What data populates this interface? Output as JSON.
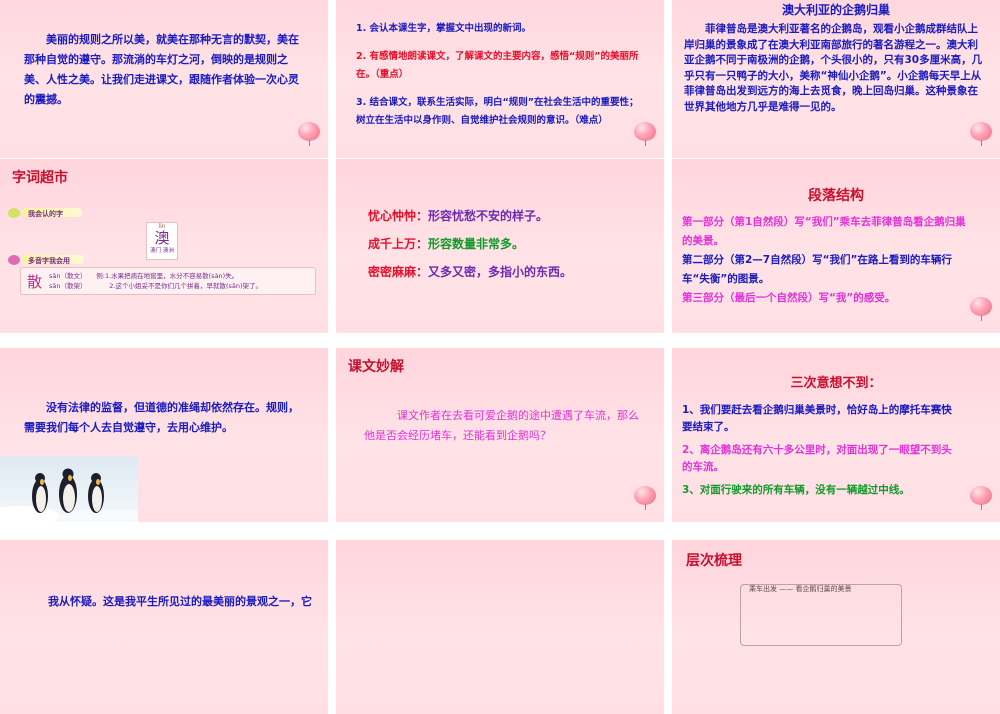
{
  "slides": {
    "s1": {
      "text": "美丽的规则之所以美，就美在那种无言的默契，美在那种自觉的遵守。那流淌的车灯之河，倒映的是规则之美、人性之美。让我们走进课文，跟随作者体验一次心灵的震撼。"
    },
    "s2": {
      "items": [
        "1. 会认本课生字，掌握文中出现的新词。",
        "2. 有感情地朗读课文，了解课文的主要内容，感悟“规则”的美丽所在。（重点）",
        "3. 结合课文，联系生活实际，明白“规则”在社会生活中的重要性；树立在生活中以身作则、自觉维护社会规则的意识。（难点）"
      ]
    },
    "s3": {
      "title": "澳大利亚的企鹅归巢",
      "text": "菲律普岛是澳大利亚著名的企鹅岛，观看小企鹅成群结队上岸归巢的景象成了在澳大利亚南部旅行的著名游程之一。澳大利亚企鹅不同于南极洲的企鹅，个头很小的，只有30多厘米高，几乎只有一只鸭子的大小，美称“神仙小企鹅”。小企鹅每天早上从菲律普岛出发到远方的海上去觅食，晚上回岛归巢。这种景象在世界其他地方几乎是难得一见的。"
    },
    "s4": {
      "title": "字词超市",
      "label1": "我会认的字",
      "card_pinyin": "lín",
      "card_char": "澳",
      "card_words": "澳门 澳洲",
      "label2": "多音字我会用",
      "poly_char": "散",
      "poly_rows": [
        {
          "reading": "sǎn（散文）",
          "example": "例:1.水果把病在地窖里，水分不容易散(sàn)失。"
        },
        {
          "reading": "sǎn（散架）",
          "example": "2.这个小姐妥不是你们几个拼着，早就散(sǎn)架了。"
        }
      ]
    },
    "s5": {
      "rows": [
        {
          "term": "忧心忡忡：",
          "def": "形容忧愁不安的样子。"
        },
        {
          "term": "成千上万：",
          "def": "形容数量非常多。"
        },
        {
          "term": "密密麻麻：",
          "def": "又多又密，多指小的东西。"
        }
      ]
    },
    "s6": {
      "title": "段落结构",
      "parts": [
        "第一部分（第1自然段）写“我们”乘车去菲律普岛看企鹅归巢的美景。",
        "第二部分（第2—7自然段）写“我们”在路上看到的车辆行车“失衡”的图景。",
        "第三部分（最后一个自然段）写“我”的感受。"
      ]
    },
    "s7": {
      "text": "没有法律的监督，但道德的准绳却依然存在。规则，需要我们每个人去自觉遵守，去用心维护。"
    },
    "s8": {
      "title": "课文妙解",
      "text": "课文作者在去看可爱企鹅的途中遭遇了车流，那么他是否会经历堵车，还能看到企鹅吗？"
    },
    "s9": {
      "title": "三次意想不到：",
      "items": [
        "1、我们要赶去看企鹅归巢美景时，恰好岛上的摩托车赛快要结束了。",
        "2、离企鹅岛还有六十多公里时，对面出现了一眼望不到头的车流。",
        "3、对面行驶来的所有车辆，没有一辆越过中线。"
      ]
    },
    "s10": {
      "text": "我从怀疑。这是我平生所见过的最美丽的景观之一，它"
    },
    "s12": {
      "title": "层次梳理",
      "box_line": "乘车出发 —— 看企鹅归巢的美景"
    }
  },
  "colors": {
    "background": "#ffe0e5",
    "title_red": "#c8102e",
    "text_blue": "#1b1bbf"
  }
}
